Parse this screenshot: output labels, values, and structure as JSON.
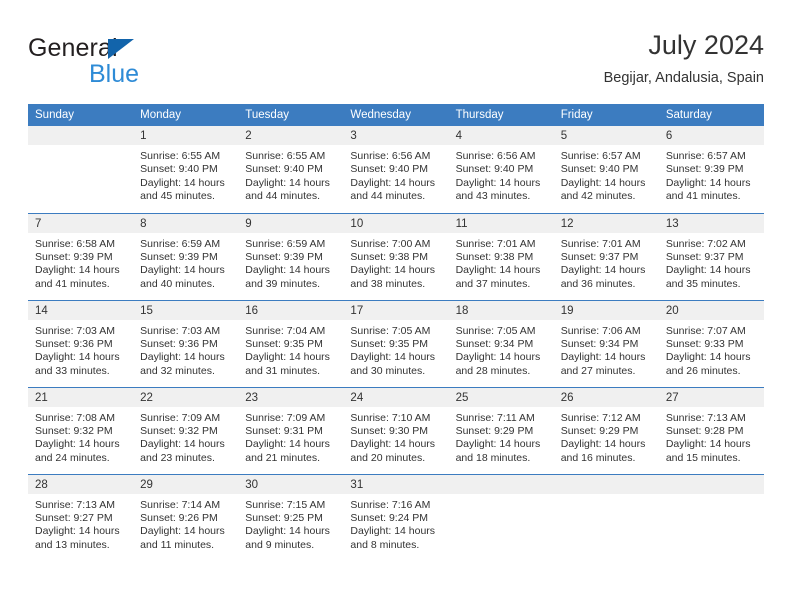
{
  "brand": {
    "word1": "General",
    "word2": "Blue",
    "triangle_color": "#1264ab",
    "word2_color": "#2e8bd6"
  },
  "header": {
    "title": "July 2024",
    "subtitle": "Begijar, Andalusia, Spain"
  },
  "theme": {
    "header_bg": "#3c7cc0",
    "header_text": "#ffffff",
    "daynum_bg": "#f0f0f0",
    "row_divider": "#3c7cc0",
    "text": "#333333"
  },
  "weekdays": [
    "Sunday",
    "Monday",
    "Tuesday",
    "Wednesday",
    "Thursday",
    "Friday",
    "Saturday"
  ],
  "weeks": [
    [
      {
        "day": ""
      },
      {
        "day": "1",
        "sunrise": "Sunrise: 6:55 AM",
        "sunset": "Sunset: 9:40 PM",
        "daylight1": "Daylight: 14 hours",
        "daylight2": "and 45 minutes."
      },
      {
        "day": "2",
        "sunrise": "Sunrise: 6:55 AM",
        "sunset": "Sunset: 9:40 PM",
        "daylight1": "Daylight: 14 hours",
        "daylight2": "and 44 minutes."
      },
      {
        "day": "3",
        "sunrise": "Sunrise: 6:56 AM",
        "sunset": "Sunset: 9:40 PM",
        "daylight1": "Daylight: 14 hours",
        "daylight2": "and 44 minutes."
      },
      {
        "day": "4",
        "sunrise": "Sunrise: 6:56 AM",
        "sunset": "Sunset: 9:40 PM",
        "daylight1": "Daylight: 14 hours",
        "daylight2": "and 43 minutes."
      },
      {
        "day": "5",
        "sunrise": "Sunrise: 6:57 AM",
        "sunset": "Sunset: 9:40 PM",
        "daylight1": "Daylight: 14 hours",
        "daylight2": "and 42 minutes."
      },
      {
        "day": "6",
        "sunrise": "Sunrise: 6:57 AM",
        "sunset": "Sunset: 9:39 PM",
        "daylight1": "Daylight: 14 hours",
        "daylight2": "and 41 minutes."
      }
    ],
    [
      {
        "day": "7",
        "sunrise": "Sunrise: 6:58 AM",
        "sunset": "Sunset: 9:39 PM",
        "daylight1": "Daylight: 14 hours",
        "daylight2": "and 41 minutes."
      },
      {
        "day": "8",
        "sunrise": "Sunrise: 6:59 AM",
        "sunset": "Sunset: 9:39 PM",
        "daylight1": "Daylight: 14 hours",
        "daylight2": "and 40 minutes."
      },
      {
        "day": "9",
        "sunrise": "Sunrise: 6:59 AM",
        "sunset": "Sunset: 9:39 PM",
        "daylight1": "Daylight: 14 hours",
        "daylight2": "and 39 minutes."
      },
      {
        "day": "10",
        "sunrise": "Sunrise: 7:00 AM",
        "sunset": "Sunset: 9:38 PM",
        "daylight1": "Daylight: 14 hours",
        "daylight2": "and 38 minutes."
      },
      {
        "day": "11",
        "sunrise": "Sunrise: 7:01 AM",
        "sunset": "Sunset: 9:38 PM",
        "daylight1": "Daylight: 14 hours",
        "daylight2": "and 37 minutes."
      },
      {
        "day": "12",
        "sunrise": "Sunrise: 7:01 AM",
        "sunset": "Sunset: 9:37 PM",
        "daylight1": "Daylight: 14 hours",
        "daylight2": "and 36 minutes."
      },
      {
        "day": "13",
        "sunrise": "Sunrise: 7:02 AM",
        "sunset": "Sunset: 9:37 PM",
        "daylight1": "Daylight: 14 hours",
        "daylight2": "and 35 minutes."
      }
    ],
    [
      {
        "day": "14",
        "sunrise": "Sunrise: 7:03 AM",
        "sunset": "Sunset: 9:36 PM",
        "daylight1": "Daylight: 14 hours",
        "daylight2": "and 33 minutes."
      },
      {
        "day": "15",
        "sunrise": "Sunrise: 7:03 AM",
        "sunset": "Sunset: 9:36 PM",
        "daylight1": "Daylight: 14 hours",
        "daylight2": "and 32 minutes."
      },
      {
        "day": "16",
        "sunrise": "Sunrise: 7:04 AM",
        "sunset": "Sunset: 9:35 PM",
        "daylight1": "Daylight: 14 hours",
        "daylight2": "and 31 minutes."
      },
      {
        "day": "17",
        "sunrise": "Sunrise: 7:05 AM",
        "sunset": "Sunset: 9:35 PM",
        "daylight1": "Daylight: 14 hours",
        "daylight2": "and 30 minutes."
      },
      {
        "day": "18",
        "sunrise": "Sunrise: 7:05 AM",
        "sunset": "Sunset: 9:34 PM",
        "daylight1": "Daylight: 14 hours",
        "daylight2": "and 28 minutes."
      },
      {
        "day": "19",
        "sunrise": "Sunrise: 7:06 AM",
        "sunset": "Sunset: 9:34 PM",
        "daylight1": "Daylight: 14 hours",
        "daylight2": "and 27 minutes."
      },
      {
        "day": "20",
        "sunrise": "Sunrise: 7:07 AM",
        "sunset": "Sunset: 9:33 PM",
        "daylight1": "Daylight: 14 hours",
        "daylight2": "and 26 minutes."
      }
    ],
    [
      {
        "day": "21",
        "sunrise": "Sunrise: 7:08 AM",
        "sunset": "Sunset: 9:32 PM",
        "daylight1": "Daylight: 14 hours",
        "daylight2": "and 24 minutes."
      },
      {
        "day": "22",
        "sunrise": "Sunrise: 7:09 AM",
        "sunset": "Sunset: 9:32 PM",
        "daylight1": "Daylight: 14 hours",
        "daylight2": "and 23 minutes."
      },
      {
        "day": "23",
        "sunrise": "Sunrise: 7:09 AM",
        "sunset": "Sunset: 9:31 PM",
        "daylight1": "Daylight: 14 hours",
        "daylight2": "and 21 minutes."
      },
      {
        "day": "24",
        "sunrise": "Sunrise: 7:10 AM",
        "sunset": "Sunset: 9:30 PM",
        "daylight1": "Daylight: 14 hours",
        "daylight2": "and 20 minutes."
      },
      {
        "day": "25",
        "sunrise": "Sunrise: 7:11 AM",
        "sunset": "Sunset: 9:29 PM",
        "daylight1": "Daylight: 14 hours",
        "daylight2": "and 18 minutes."
      },
      {
        "day": "26",
        "sunrise": "Sunrise: 7:12 AM",
        "sunset": "Sunset: 9:29 PM",
        "daylight1": "Daylight: 14 hours",
        "daylight2": "and 16 minutes."
      },
      {
        "day": "27",
        "sunrise": "Sunrise: 7:13 AM",
        "sunset": "Sunset: 9:28 PM",
        "daylight1": "Daylight: 14 hours",
        "daylight2": "and 15 minutes."
      }
    ],
    [
      {
        "day": "28",
        "sunrise": "Sunrise: 7:13 AM",
        "sunset": "Sunset: 9:27 PM",
        "daylight1": "Daylight: 14 hours",
        "daylight2": "and 13 minutes."
      },
      {
        "day": "29",
        "sunrise": "Sunrise: 7:14 AM",
        "sunset": "Sunset: 9:26 PM",
        "daylight1": "Daylight: 14 hours",
        "daylight2": "and 11 minutes."
      },
      {
        "day": "30",
        "sunrise": "Sunrise: 7:15 AM",
        "sunset": "Sunset: 9:25 PM",
        "daylight1": "Daylight: 14 hours",
        "daylight2": "and 9 minutes."
      },
      {
        "day": "31",
        "sunrise": "Sunrise: 7:16 AM",
        "sunset": "Sunset: 9:24 PM",
        "daylight1": "Daylight: 14 hours",
        "daylight2": "and 8 minutes."
      },
      {
        "day": ""
      },
      {
        "day": ""
      },
      {
        "day": ""
      }
    ]
  ]
}
